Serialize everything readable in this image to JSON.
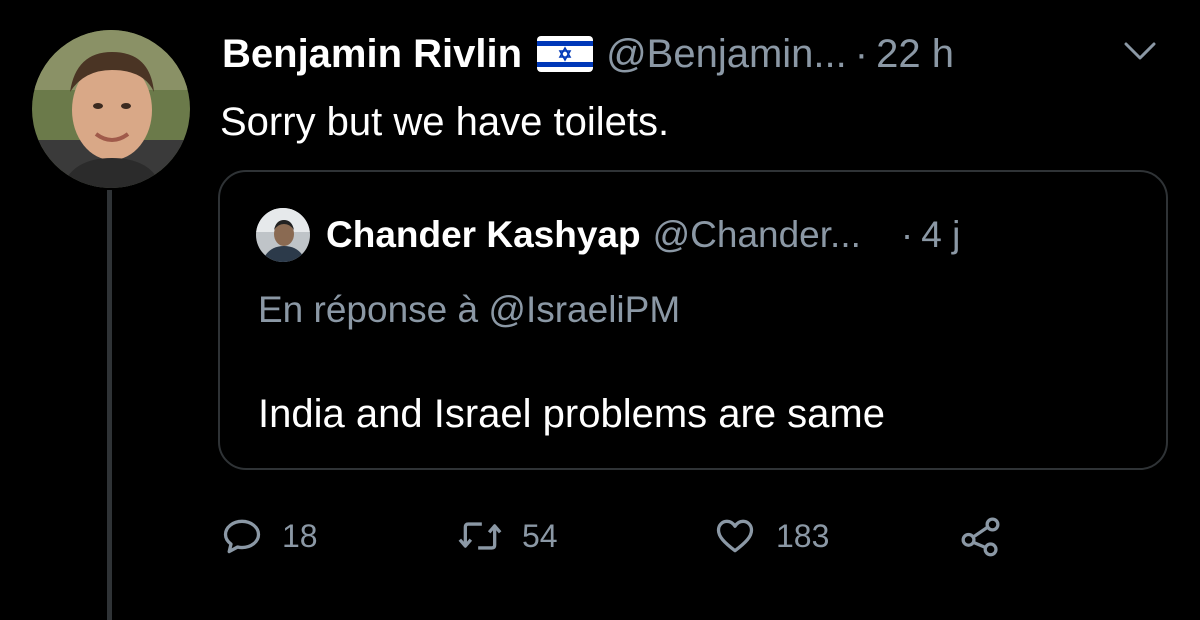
{
  "tweet": {
    "author_name": "Benjamin Rivlin",
    "author_handle": "@Benjamin...",
    "separator": "·",
    "time": "22 h",
    "text": "Sorry but we have toilets."
  },
  "quoted_tweet": {
    "author_name": "Chander Kashyap",
    "author_handle": "@Chander...",
    "separator": "·",
    "time": "4 j",
    "reply_context": "En réponse à @IsraeliPM",
    "text": "India and Israel problems are same"
  },
  "actions": {
    "replies": "18",
    "retweets": "54",
    "likes": "183"
  },
  "icons": {
    "flag": "israel-flag-icon",
    "menu": "chevron-down-icon",
    "reply": "reply-icon",
    "retweet": "retweet-icon",
    "like": "heart-icon",
    "share": "share-icon"
  },
  "colors": {
    "background": "#000000",
    "primary_text": "#ffffff",
    "secondary_text": "#8b98a5",
    "border": "#2f3336",
    "flag_blue": "#0038b8"
  }
}
